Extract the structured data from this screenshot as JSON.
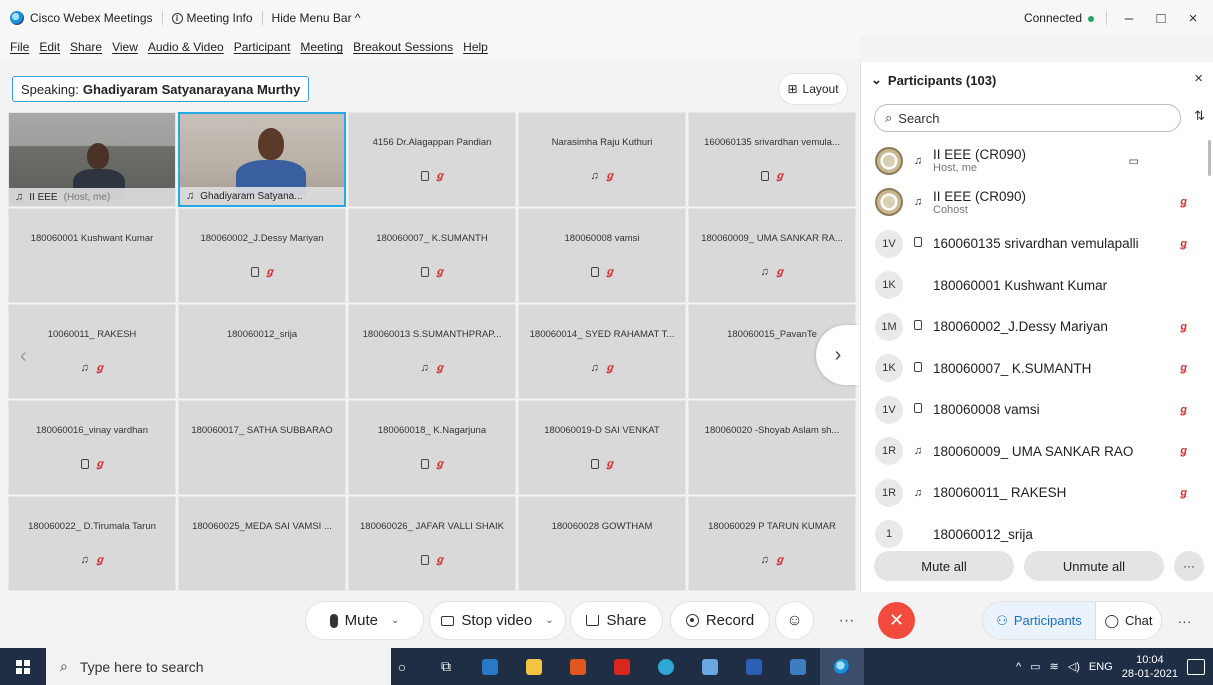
{
  "window": {
    "app_title": "Cisco Webex Meetings",
    "meeting_info": "Meeting Info",
    "hide_menu_bar": "Hide Menu Bar ^",
    "status": "Connected",
    "controls": [
      "–",
      "□",
      "×"
    ]
  },
  "menu": [
    "File",
    "Edit",
    "Share",
    "View",
    "Audio & Video",
    "Participant",
    "Meeting",
    "Breakout Sessions",
    "Help"
  ],
  "stage": {
    "speaking_label": "Speaking:",
    "speaking_name": "Ghadiyaram Satyanarayana Murthy",
    "layout_label": "Layout"
  },
  "tiles": [
    {
      "name": "II EEE",
      "sub": "(Host, me)",
      "video": true
    },
    {
      "name": "Ghadiyaram Satyana...",
      "video": true,
      "active": true
    },
    {
      "name": "4156 Dr.Alagappan Pandian",
      "icons": [
        "phone",
        "mute"
      ]
    },
    {
      "name": "Narasimha Raju Kuthuri",
      "icons": [
        "headset",
        "mute"
      ]
    },
    {
      "name": "160060135 srivardhan vemula...",
      "icons": [
        "phone",
        "mute"
      ]
    },
    {
      "name": "180060001 Kushwant Kumar",
      "icons": []
    },
    {
      "name": "180060002_J.Dessy Mariyan",
      "icons": [
        "phone",
        "mute"
      ]
    },
    {
      "name": "180060007_ K.SUMANTH",
      "icons": [
        "phone",
        "mute"
      ]
    },
    {
      "name": "180060008 vamsi",
      "icons": [
        "phone",
        "mute"
      ]
    },
    {
      "name": "180060009_ UMA SANKAR RA...",
      "icons": [
        "headset",
        "mute"
      ]
    },
    {
      "name": "10060011_ RAKESH",
      "icons": [
        "headset",
        "mute"
      ]
    },
    {
      "name": "180060012_srija",
      "icons": []
    },
    {
      "name": "180060013 S.SUMANTHPRAP...",
      "icons": [
        "headset",
        "mute"
      ]
    },
    {
      "name": "180060014_ SYED RAHAMAT T...",
      "icons": [
        "headset",
        "mute"
      ]
    },
    {
      "name": "180060015_PavanTe",
      "icons": []
    },
    {
      "name": "180060016_vinay vardhan",
      "icons": [
        "phone",
        "mute"
      ]
    },
    {
      "name": "180060017_ SATHA SUBBARAO",
      "icons": []
    },
    {
      "name": "180060018_ K.Nagarjuna",
      "icons": [
        "phone",
        "mute"
      ]
    },
    {
      "name": "180060019-D SAI VENKAT",
      "icons": [
        "phone",
        "mute"
      ]
    },
    {
      "name": "180060020 -Shoyab Aslam sh...",
      "icons": []
    },
    {
      "name": "180060022_ D.Tirumala Tarun",
      "icons": [
        "headset",
        "mute"
      ]
    },
    {
      "name": "180060025_MEDA SAI VAMSI ...",
      "icons": []
    },
    {
      "name": "180060026_ JAFAR VALLI SHAIK",
      "icons": [
        "phone",
        "mute"
      ]
    },
    {
      "name": "180060028 GOWTHAM",
      "icons": []
    },
    {
      "name": "180060029 P TARUN KUMAR",
      "icons": [
        "headset",
        "mute"
      ]
    }
  ],
  "panel": {
    "title": "Participants (103)",
    "search_placeholder": "Search",
    "participants": [
      {
        "avatar": "",
        "logo": true,
        "icon": "headset",
        "name": "II EEE (CR090)",
        "sub": "Host, me",
        "camera": true,
        "muted": false
      },
      {
        "avatar": "",
        "logo": true,
        "icon": "headset",
        "name": "II EEE (CR090)",
        "sub": "Cohost",
        "camera": false,
        "muted": true
      },
      {
        "avatar": "1V",
        "icon": "phone",
        "name": "160060135 srivardhan vemulapalli",
        "sub": "",
        "muted": true
      },
      {
        "avatar": "1K",
        "icon": "",
        "name": "180060001 Kushwant Kumar",
        "sub": "",
        "muted": false
      },
      {
        "avatar": "1M",
        "icon": "phone",
        "name": "180060002_J.Dessy Mariyan",
        "sub": "",
        "muted": true
      },
      {
        "avatar": "1K",
        "icon": "phone",
        "name": "180060007_ K.SUMANTH",
        "sub": "",
        "muted": true
      },
      {
        "avatar": "1V",
        "icon": "phone",
        "name": "180060008 vamsi",
        "sub": "",
        "muted": true
      },
      {
        "avatar": "1R",
        "icon": "headset",
        "name": "180060009_ UMA SANKAR RAO",
        "sub": "",
        "muted": true
      },
      {
        "avatar": "1R",
        "icon": "headset",
        "name": "180060011_ RAKESH",
        "sub": "",
        "muted": true
      },
      {
        "avatar": "1",
        "icon": "",
        "name": "180060012_srija",
        "sub": "",
        "muted": false
      }
    ],
    "mute_all": "Mute all",
    "unmute_all": "Unmute all",
    "more": "···"
  },
  "toolbar": {
    "mute": "Mute",
    "stop_video": "Stop video",
    "share": "Share",
    "record": "Record",
    "more": "···",
    "end": "✕",
    "participants": "Participants",
    "chat": "Chat",
    "more_right": "···"
  },
  "taskbar": {
    "search_placeholder": "Type here to search",
    "lang": "ENG",
    "time": "10:04",
    "date": "28-01-2021"
  },
  "colors": {
    "accent_blue": "#1770c2",
    "active_border": "#25a8e6",
    "muted_red": "#d32f2f",
    "end_red": "#f24a3c",
    "taskbar": "#1f2e45"
  }
}
